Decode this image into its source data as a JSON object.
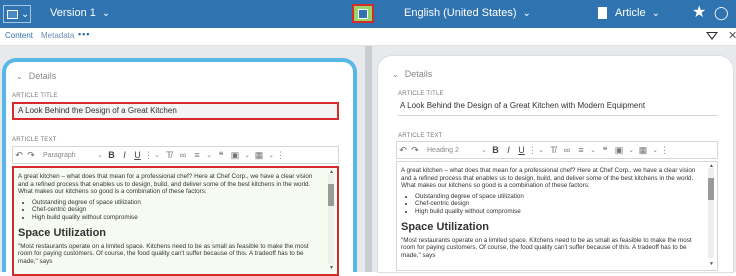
{
  "topbar": {
    "version_label": "Version 1",
    "language_label": "English (United States)",
    "content_type_label": "Article"
  },
  "tabs": {
    "content": "Content",
    "metadata": "Metadata",
    "more": "•••"
  },
  "left_panel": {
    "details_label": "Details",
    "title_label": "ARTICLE TITLE",
    "title_value": "A Look Behind the Design of a Great Kitchen",
    "text_label": "ARTICLE TEXT",
    "paragraph_style": "Paragraph",
    "body_intro": "A great kitchen – what does that mean for a professional chef? Here at Chef Corp., we have a clear vision and a refined process that enables us to design, build, and deliver some of the best kitchens in the world. What makes our kitchens so good is a combination of these factors:",
    "bullets": [
      "Outstanding degree of space utilization",
      "Chef-centric design",
      "High build quality without compromise"
    ],
    "heading": "Space Utilization",
    "quote": "\"Most restaurants operate on a limited space. Kitchens need to be as small as feasible to make the most room for paying customers. Of course, the food quality can't suffer because of this. A tradeoff has to be made,\" says"
  },
  "right_panel": {
    "details_label": "Details",
    "title_label": "ARTICLE TITLE",
    "title_value": "A Look Behind the Design of a Great Kitchen with Modern Equipment",
    "text_label": "ARTICLE TEXT",
    "paragraph_style": "Heading 2",
    "body_intro": "A great kitchen – what does that mean for a professional chef? Here at Chef Corp., we have a clear vision and a refined process that enables us to design, build, and deliver some of the best kitchens in the world. What makes our kitchens so good is a combination of these factors:",
    "bullets": [
      "Outstanding degree of space utilization",
      "Chef-centric design",
      "High build quality without compromise"
    ],
    "heading": "Space Utilization",
    "quote": "\"Most restaurants operate on a limited space. Kitchens need to be as small as feasible to make the most room for paying customers. Of course, the food quality can't suffer because of this. A tradeoff has to be made,\" says"
  },
  "icons": [
    "sidebar-toggle-icon",
    "compare-icon",
    "content-type-icon",
    "star-icon",
    "lightbulb-icon",
    "filter-icon",
    "close-icon",
    "undo-icon",
    "redo-icon",
    "link-icon",
    "align-icon",
    "quote-icon",
    "image-icon",
    "table-icon"
  ],
  "colors": {
    "topbar": "#2f73b0",
    "highlight": "#d62b2b",
    "panel_border": "#57b8e6",
    "compare_button": "#9bd36b"
  }
}
